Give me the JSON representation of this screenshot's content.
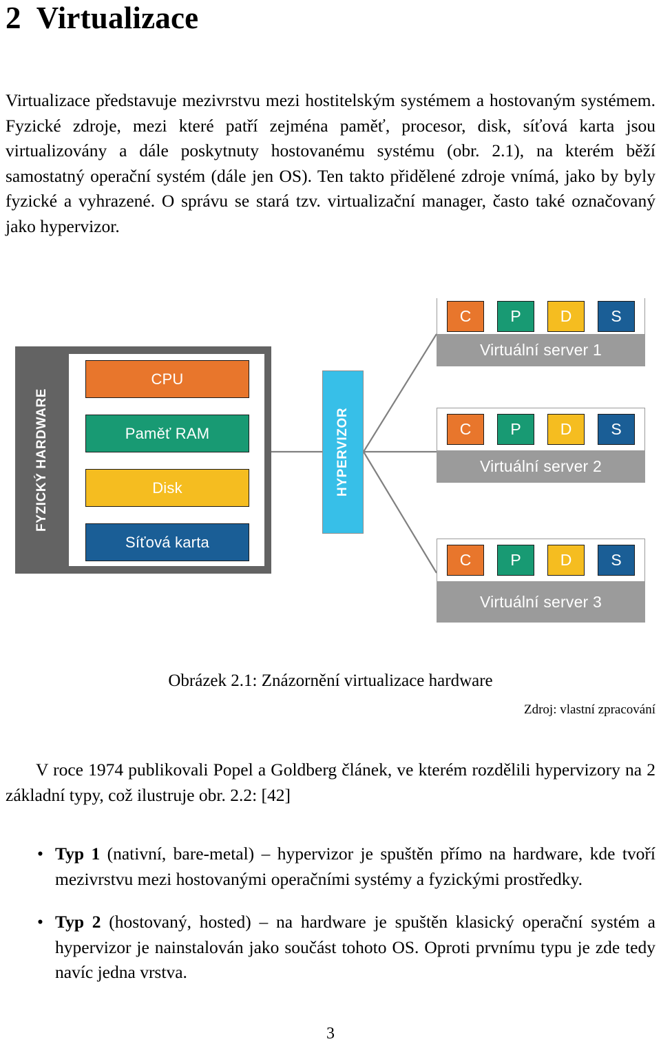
{
  "document": {
    "chapter_number": "2",
    "chapter_title": "Virtualizace",
    "intro_paragraph": "Virtualizace představuje mezivrstvu mezi hostitelským systémem a hostovaným systémem. Fyzické zdroje, mezi které patří zejména paměť, procesor, disk, síťová karta jsou virtualizovány a dále poskytnuty hostovanému systému (obr. 2.1), na kterém běží samostatný operační systém (dále jen OS). Ten takto přidělené zdroje vnímá, jako by byly fyzické a vyhrazené. O správu se stará tzv. virtualizační manager, často také označovaný jako hypervizor.",
    "figure_caption": "Obrázek 2.1: Znázornění virtualizace hardware",
    "figure_source": "Zdroj: vlastní zpracování",
    "popel_paragraph": "V roce 1974 publikovali Popel a Goldberg článek, ve kterém rozdělili hypervizory na 2 základní typy, což ilustruje obr. 2.2: [42]",
    "bullets": [
      {
        "marker": "•",
        "bold_label": "Typ 1",
        "text": " (nativní, bare-metal) – hypervizor je spuštěn přímo na hardware, kde tvoří mezivrstvu mezi hostovanými operačními systémy a fyzickými prostředky."
      },
      {
        "marker": "•",
        "bold_label": "Typ 2",
        "text": " (hostovaný, hosted) – na hardware je spuštěn klasický operační systém a hypervizor je nainstalován jako součást tohoto OS. Oproti prvnímu typu je zde tedy navíc jedna vrstva."
      }
    ],
    "page_number": "3"
  },
  "figure": {
    "physical_hardware_label": "FYZICKÝ HARDWARE",
    "hardware_resources": [
      {
        "label": "CPU",
        "color": "#E8762C"
      },
      {
        "label": "Paměť RAM",
        "color": "#189A73"
      },
      {
        "label": "Disk",
        "color": "#F5BD20"
      },
      {
        "label": "Síťová karta",
        "color": "#1A5E96"
      }
    ],
    "hypervisor_label": "HYPERVIZOR",
    "hypervisor_color": "#37BFE8",
    "virtual_servers": [
      {
        "label": "Virtuální server 1",
        "chips": [
          {
            "letter": "C",
            "color": "#E8762C"
          },
          {
            "letter": "P",
            "color": "#189A73"
          },
          {
            "letter": "D",
            "color": "#F5BD20"
          },
          {
            "letter": "S",
            "color": "#1A5E96"
          }
        ]
      },
      {
        "label": "Virtuální server 2",
        "chips": [
          {
            "letter": "C",
            "color": "#E8762C"
          },
          {
            "letter": "P",
            "color": "#189A73"
          },
          {
            "letter": "D",
            "color": "#F5BD20"
          },
          {
            "letter": "S",
            "color": "#1A5E96"
          }
        ]
      },
      {
        "label": "Virtuální server 3",
        "chips": [
          {
            "letter": "C",
            "color": "#E8762C"
          },
          {
            "letter": "P",
            "color": "#189A73"
          },
          {
            "letter": "D",
            "color": "#F5BD20"
          },
          {
            "letter": "S",
            "color": "#1A5E96"
          }
        ]
      }
    ],
    "frame_color": "#636363",
    "server_label_color": "#9B9B9B",
    "connector_color": "#808080"
  }
}
